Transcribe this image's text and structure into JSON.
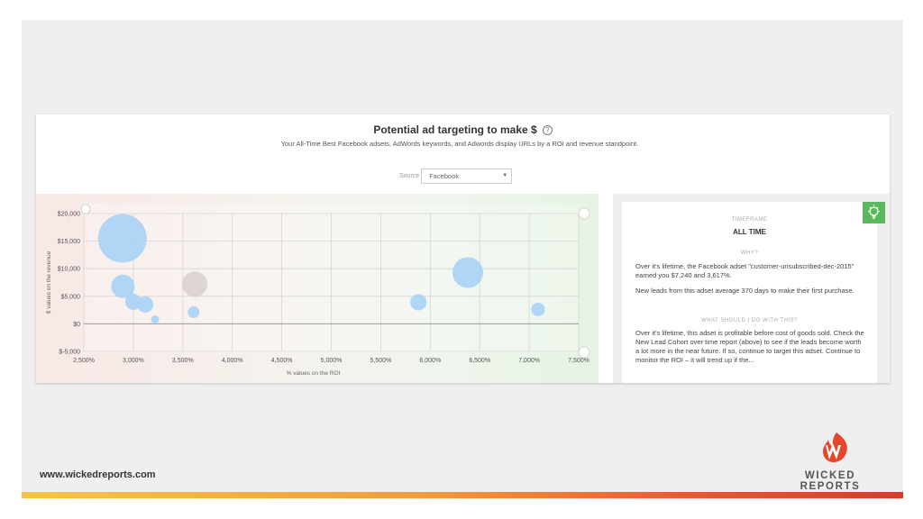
{
  "footer": {
    "url": "www.wickedreports.com",
    "brand": "WICKED REPORTS"
  },
  "card": {
    "title": "Potential ad targeting to make $",
    "help_icon": "?",
    "subtitle": "Your All-Time Best Facebook adsets, AdWords keywords, and Adwords display URLs by a ROI and revenue standpoint.",
    "source_label": "Source",
    "source_value": "Facebook"
  },
  "chart_data": {
    "type": "scatter",
    "xlabel": "% values on the ROI",
    "ylabel": "$ values on the revenue",
    "xlim": [
      2500,
      7500
    ],
    "ylim": [
      -5000,
      20000
    ],
    "x_ticks": [
      "2,500%",
      "3,000%",
      "3,500%",
      "4,000%",
      "4,500%",
      "5,000%",
      "5,500%",
      "6,000%",
      "6,500%",
      "7,000%",
      "7,500%"
    ],
    "y_ticks": [
      "$-5,000",
      "$0",
      "$5,000",
      "$10,000",
      "$15,000",
      "$20,000"
    ],
    "grid": true,
    "points": [
      {
        "x": 2890,
        "y": 15500,
        "size": 27,
        "color": "#a9d2f5"
      },
      {
        "x": 2895,
        "y": 6800,
        "size": 13,
        "color": "#a9d2f5"
      },
      {
        "x": 3000,
        "y": 4000,
        "size": 9,
        "color": "#a9d2f5"
      },
      {
        "x": 3120,
        "y": 3500,
        "size": 9,
        "color": "#a9d2f5"
      },
      {
        "x": 3220,
        "y": 800,
        "size": 4.5,
        "color": "#a9d2f5"
      },
      {
        "x": 3620,
        "y": 7200,
        "size": 14,
        "color": "#d9d3cf"
      },
      {
        "x": 3610,
        "y": 2100,
        "size": 6.5,
        "color": "#a9d2f5"
      },
      {
        "x": 5880,
        "y": 3900,
        "size": 9,
        "color": "#a9d2f5"
      },
      {
        "x": 6380,
        "y": 9300,
        "size": 17,
        "color": "#a9d2f5"
      },
      {
        "x": 7090,
        "y": 2600,
        "size": 7.5,
        "color": "#a9d2f5"
      }
    ]
  },
  "panel": {
    "timeframe_label": "TIMEFRAME",
    "timeframe_value": "ALL TIME",
    "why_label": "WHY?",
    "why_text_1": "Over it's lifetime, the Facebook adset \"customer-unsubscribed-dec-2015\" earned you $7,240 and 3,617%.",
    "why_text_2": "New leads from this adset average 370 days to make their first purchase.",
    "action_label": "WHAT SHOULD I DO WITH THIS?",
    "action_text": "Over it's lifetime, this adset is profitable before cost of goods sold. Check the New Lead Cohort over time report (above) to see if the leads become worth a lot more in the near future. If so, continue to target this adset. Continue to monitor the ROI – it will trend up if the..."
  },
  "colors": {
    "accent_green": "#5cb85c",
    "bubble_blue": "#a9d2f5",
    "bubble_gray": "#d9d3cf"
  }
}
